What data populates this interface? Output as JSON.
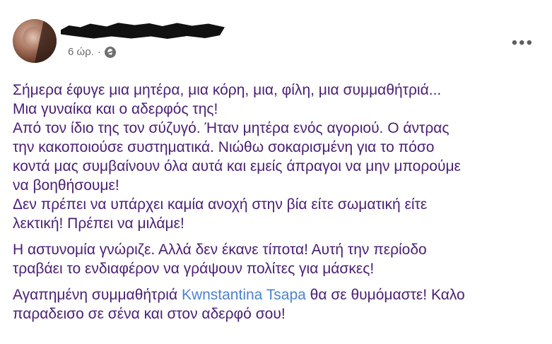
{
  "post": {
    "meta": {
      "time": "6 ώρ.",
      "separator": "·",
      "icons": {
        "avatar": "profile-photo",
        "audience": "globe-icon",
        "menu": "more-options-icon"
      }
    },
    "menu_label": "•••",
    "paragraphs": [
      {
        "lines": [
          "Σήμερα έφυγε μια μητέρα, μια κόρη, μια, φίλη, μια συμμαθήτριά...",
          "Μια γυναίκα και ο αδερφός της!",
          "Από τον ίδιο της τον σύζυγό. Ήταν μητέρα ενός αγοριού. Ο άντρας",
          "την κακοποιούσε συστηματικά. Νιώθω σοκαρισμένη για το πόσο",
          "κοντά μας συμβαίνουν όλα αυτά και εμείς άπραγοι να μην μπορούμε",
          "να βοηθήσουμε!",
          "Δεν πρέπει να υπάρχει καμία ανοχή στην βία είτε σωματική είτε",
          "λεκτική! Πρέπει να μιλάμε!"
        ]
      },
      {
        "lines": [
          "Η αστυνομία γνώριζε. Αλλά δεν έκανε τίποτα! Αυτή την περίοδο",
          "τραβάει το ενδιαφέρον να γράψουν πολίτες για μάσκες!"
        ]
      },
      {
        "line_1_prefix": "Αγαπημένη συμμαθήτριά ",
        "mention": "Kwnstantina Tsapa",
        "line_1_suffix": " θα σε θυμόμαστε! Καλο",
        "line_2": "παραδεισο σε σένα και στον αδερφό σου!"
      }
    ]
  }
}
